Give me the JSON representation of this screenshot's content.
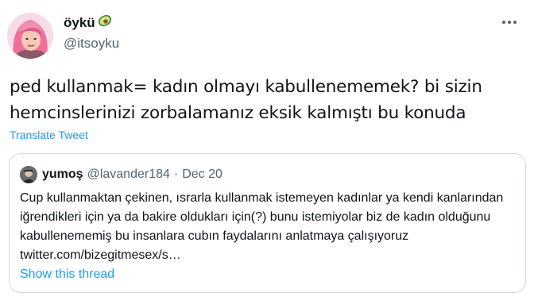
{
  "author": {
    "display_name": "öykü",
    "handle": "@itsoyku",
    "emoji": "avocado-icon"
  },
  "tweet": {
    "text": "ped kullanmak= kadın olmayı kabullenememek? bi sizin hemcinslerinizi zorbalamanız eksik kalmıştı bu konuda",
    "translate_label": "Translate Tweet"
  },
  "quoted_tweet": {
    "display_name": "yumoş",
    "handle": "@lavander184",
    "separator": "·",
    "date": "Dec 20",
    "text": "Cup kullanmaktan çekinen, ısrarla kullanmak istemeyen kadınlar ya kendi kanlarından iğrendikleri için ya da bakire oldukları için(?) bunu istemiyolar biz de kadın olduğunu kabullenememiş bu insanlara cubın faydalarını anlatmaya çalışıyoruz twitter.com/bizegitmesex/s…",
    "show_thread_label": "Show this thread"
  },
  "colors": {
    "accent": "#1d9bf0",
    "secondary_text": "#536471",
    "border": "#cfd9de"
  }
}
